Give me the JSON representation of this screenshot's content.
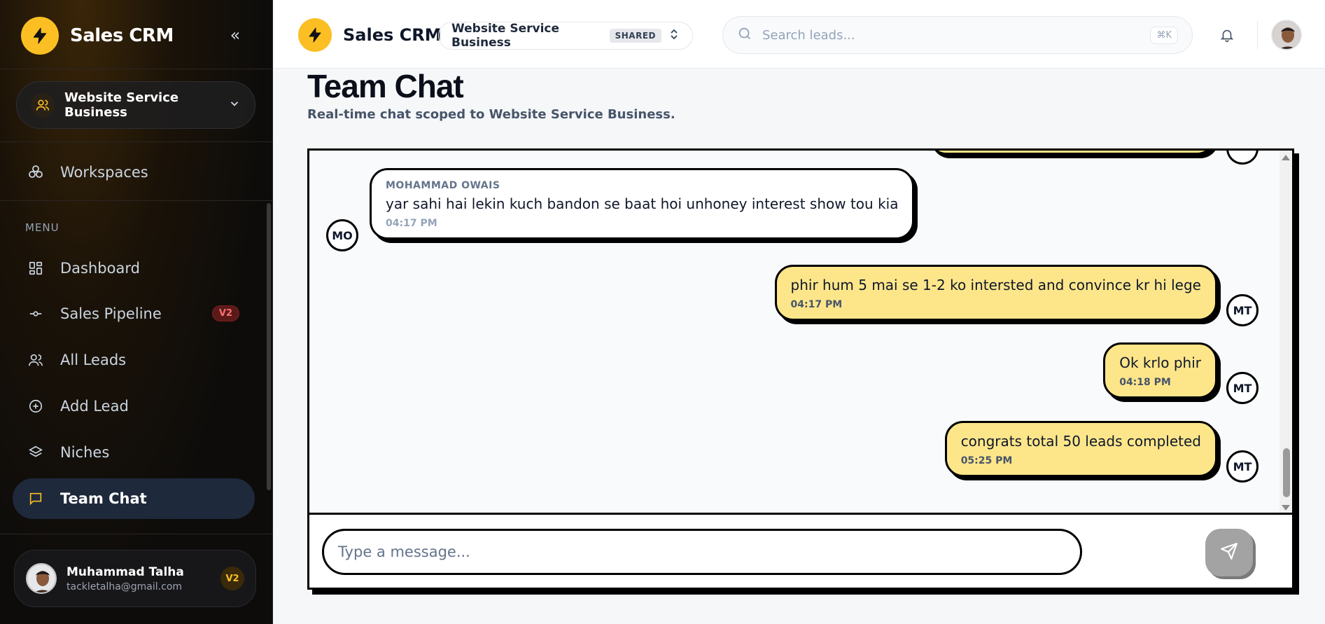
{
  "sidebar": {
    "brand": "Sales CRM",
    "workspace": "Website Service Business",
    "workspaces_label": "Workspaces",
    "menu_label": "MENU",
    "items": [
      {
        "label": "Dashboard",
        "icon": "grid-icon"
      },
      {
        "label": "Sales Pipeline",
        "icon": "pipeline-icon",
        "badge": "V2"
      },
      {
        "label": "All Leads",
        "icon": "users-icon"
      },
      {
        "label": "Add Lead",
        "icon": "plus-circle-icon"
      },
      {
        "label": "Niches",
        "icon": "layers-icon"
      },
      {
        "label": "Team Chat",
        "icon": "chat-icon",
        "active": true
      }
    ],
    "user": {
      "name": "Muhammad Talha",
      "email": "tackletalha@gmail.com",
      "badge": "V2"
    }
  },
  "header": {
    "brand": "Sales CRM",
    "workspace": "Website Service Business",
    "workspace_tag": "SHARED",
    "search_placeholder": "Search leads...",
    "shortcut": "⌘K"
  },
  "page": {
    "title": "Team Chat",
    "subtitle": "Real-time chat scoped to Website Service Business."
  },
  "chat": {
    "messages": [
      {
        "author": "MOHAMMAD OWAIS",
        "text": "yar sahi hai lekin kuch bandon se baat hoi unhoney interest show tou kia",
        "time": "04:17 PM",
        "initials": "MO",
        "mine": false
      },
      {
        "text": "phir hum 5 mai se 1-2 ko intersted and convince kr hi lege",
        "time": "04:17 PM",
        "initials": "MT",
        "mine": true
      },
      {
        "text": "Ok krlo phir",
        "time": "04:18 PM",
        "initials": "MT",
        "mine": true
      },
      {
        "text": "congrats total 50 leads completed",
        "time": "05:25 PM",
        "initials": "MT",
        "mine": true
      }
    ],
    "composer_placeholder": "Type a message..."
  },
  "colors": {
    "accent": "#fbbf24",
    "my_bubble": "#fde68a",
    "sidebar_bg": "#0d0c0b"
  }
}
